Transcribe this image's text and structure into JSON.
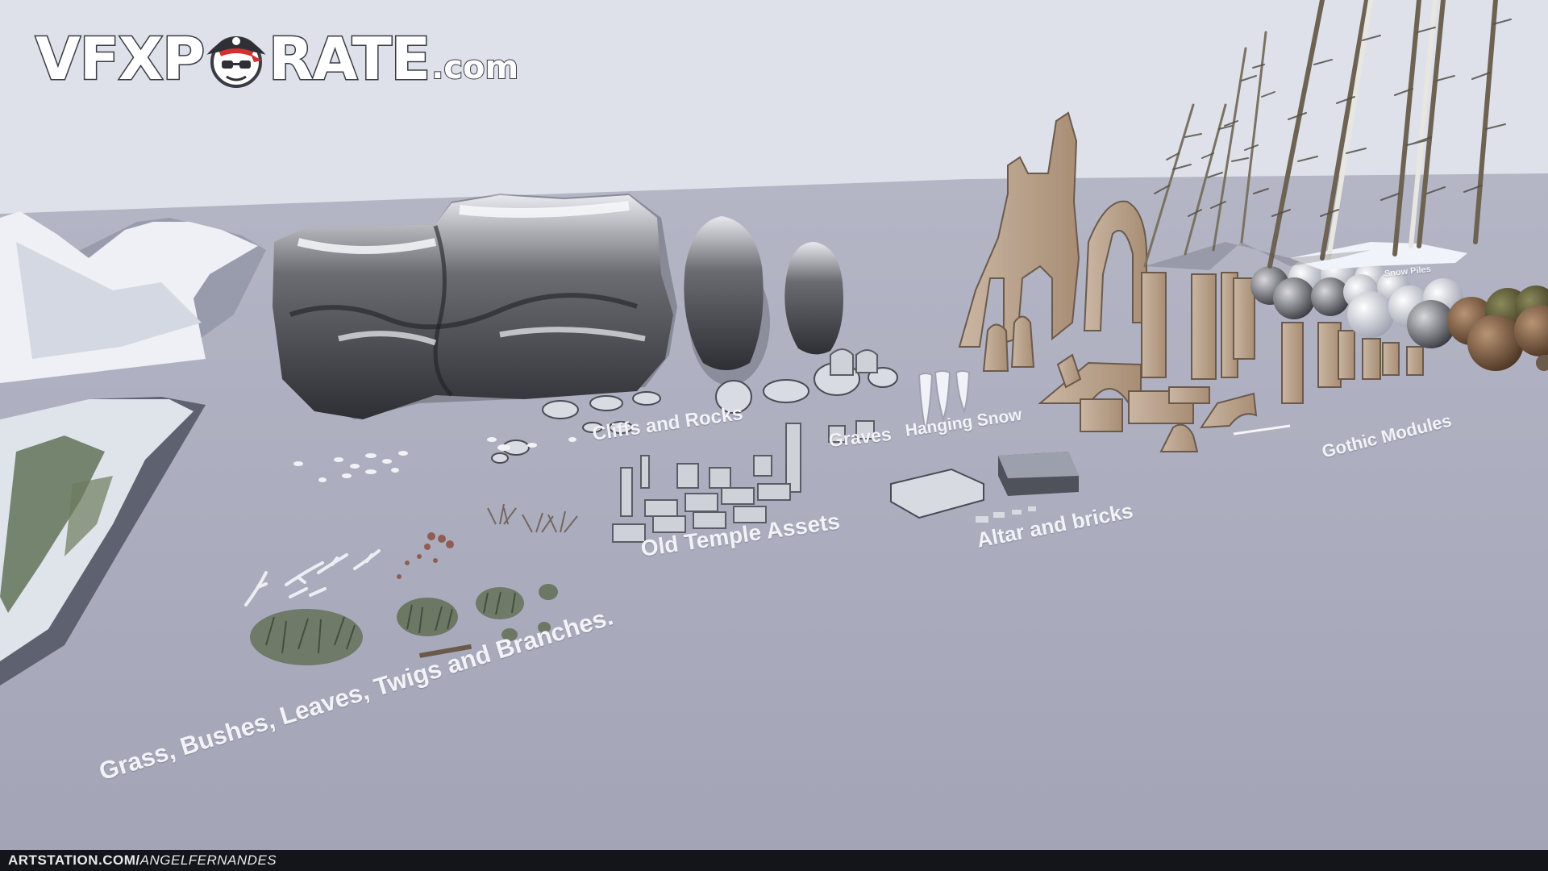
{
  "logo": {
    "text_left": "VFXP",
    "text_right": "RATE",
    "suffix": ".com",
    "icon": "pirate-skull-icon"
  },
  "labels": {
    "cliffs": "Cliffs and Rocks",
    "graves": "Graves",
    "hanging_snow": "Hanging Snow",
    "snow_piles": "Snow Piles",
    "gothic": "Gothic Modules",
    "temple": "Old Temple Assets",
    "altar": "Altar and bricks",
    "foliage": "Grass, Bushes, Leaves, Twigs and Branches."
  },
  "footer": {
    "site": "ARTSTATION.COM/",
    "user": "ANGELFERNANDES"
  },
  "colors": {
    "sky": "#dfe1ea",
    "floor": "#a9abbc",
    "label": "#f2f3f7",
    "footer_bg": "#14151a"
  }
}
